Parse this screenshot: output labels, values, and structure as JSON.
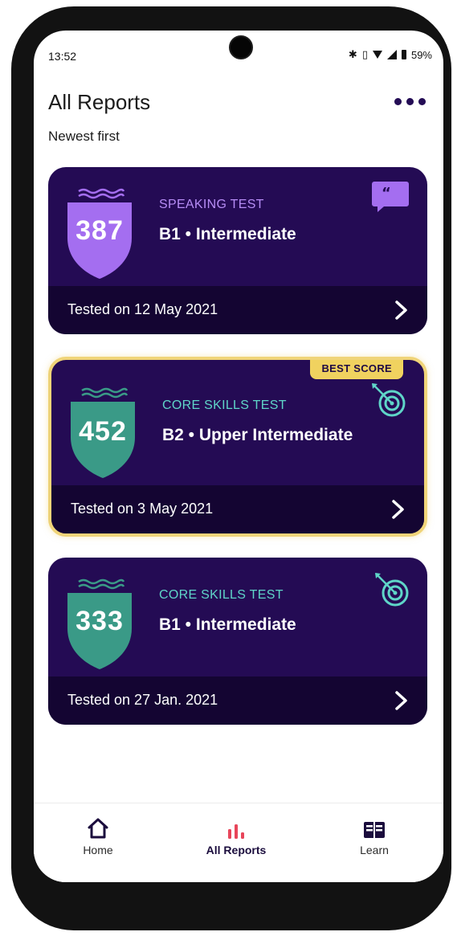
{
  "status_bar": {
    "time": "13:52",
    "battery": "59%"
  },
  "header": {
    "title": "All Reports",
    "subtitle": "Newest first",
    "more_icon": "more-horizontal-icon"
  },
  "reports": [
    {
      "test_type": "SPEAKING TEST",
      "score": "387",
      "level": "B1 • Intermediate",
      "tested": "Tested on 12 May 2021",
      "icon": "speech-bubble-icon",
      "best": false,
      "accent_color": "#a46ef0",
      "label_color": "#b68cf5"
    },
    {
      "test_type": "CORE SKILLS TEST",
      "score": "452",
      "level": "B2 • Upper Intermediate",
      "tested": "Tested on 3 May 2021",
      "icon": "target-icon",
      "best": true,
      "badge": "BEST SCORE",
      "accent_color": "#3a9a87",
      "label_color": "#5fd5c8"
    },
    {
      "test_type": "CORE SKILLS TEST",
      "score": "333",
      "level": "B1 • Intermediate",
      "tested": "Tested on 27 Jan. 2021",
      "icon": "target-icon",
      "best": false,
      "accent_color": "#3a9a87",
      "label_color": "#5fd5c8"
    }
  ],
  "bottom_nav": {
    "items": [
      {
        "label": "Home",
        "icon": "home-icon",
        "active": false
      },
      {
        "label": "All Reports",
        "icon": "bar-chart-icon",
        "active": true
      },
      {
        "label": "Learn",
        "icon": "book-icon",
        "active": false
      }
    ]
  },
  "colors": {
    "card_bg": "#240b54",
    "card_footer": "#140532",
    "best_border": "#f0d478",
    "badge_bg": "#f0d25f",
    "nav_active_icon": "#e8455a",
    "accent_purple": "#a46ef0",
    "accent_teal": "#3a9a87"
  }
}
